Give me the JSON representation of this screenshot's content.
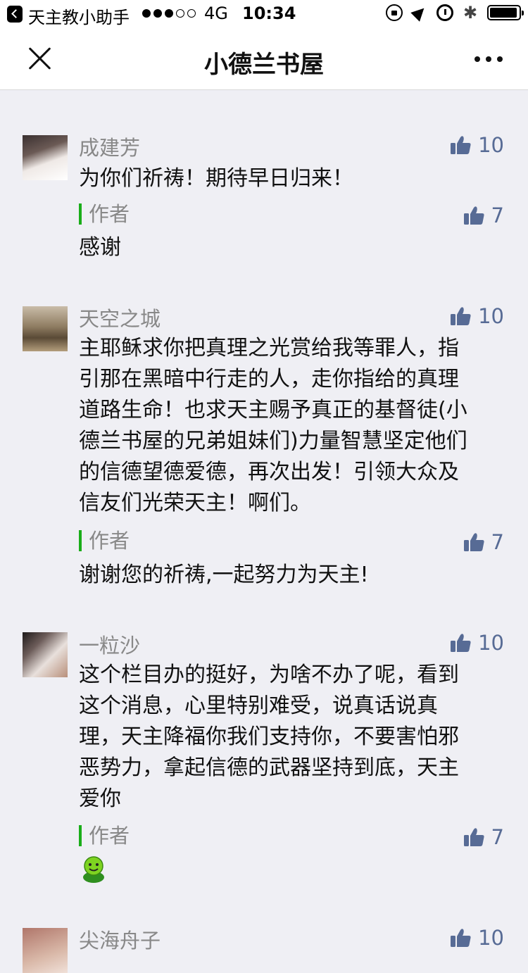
{
  "status_bar": {
    "carrier": "天主教小助手",
    "network": "4G",
    "time": "10:34",
    "signal_bars_filled": 3,
    "signal_bars_total": 5
  },
  "nav": {
    "title": "小德兰书屋"
  },
  "colors": {
    "accent": "#576b95",
    "reply_bar": "#1aad19",
    "background": "#efeff4"
  },
  "comments": [
    {
      "user": "成建芳",
      "likes": "10",
      "text": "为你们祈祷！期待早日归来！",
      "reply": {
        "label": "作者",
        "likes": "7",
        "text": "感谢"
      }
    },
    {
      "user": "天空之城",
      "likes": "10",
      "text_lines": [
        "主耶稣求你把真理之光赏给我等罪人，指",
        "引那在黑暗中行走的人，走你指给的真理",
        "道路生命！也求天主赐予真正的基督徒(小",
        "德兰书屋的兄弟姐妹们)力量智慧坚定他们",
        "的信德望德爱德，再次出发！引领大众及",
        "信友们光荣天主！啊们。"
      ],
      "reply": {
        "label": "作者",
        "likes": "7",
        "text": "谢谢您的祈祷,一起努力为天主!"
      }
    },
    {
      "user": "一粒沙",
      "likes": "10",
      "text_lines": [
        "这个栏目办的挺好，为啥不办了呢，看到",
        "这个消息，心里特别难受，说真话说真",
        "理，天主降福你我们支持你，不要害怕邪",
        "恶势力，拿起信德的武器坚持到底，天主",
        "爱你"
      ],
      "reply": {
        "label": "作者",
        "likes": "7",
        "emoji": "green-smiley"
      }
    },
    {
      "user": "尖海舟子",
      "likes": "10"
    }
  ]
}
